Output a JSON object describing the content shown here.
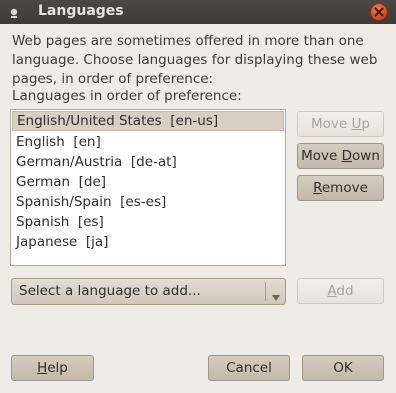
{
  "window": {
    "title": "Languages"
  },
  "intro_text": "Web pages are sometimes offered in more than one language. Choose languages for displaying these web pages, in order of preference:",
  "list_label": "Languages in order of preference:",
  "languages": [
    "English/United States  [en-us]",
    "English  [en]",
    "German/Austria  [de-at]",
    "German  [de]",
    "Spanish/Spain  [es-es]",
    "Spanish  [es]",
    "Japanese  [ja]"
  ],
  "buttons": {
    "move_up_pre": "Move ",
    "move_up_key": "U",
    "move_up_post": "p",
    "move_down_pre": "Move ",
    "move_down_key": "D",
    "move_down_post": "own",
    "remove_key": "R",
    "remove_post": "emove",
    "add_key": "A",
    "add_post": "dd",
    "help_key": "H",
    "help_post": "elp",
    "cancel": "Cancel",
    "ok": "OK"
  },
  "select": {
    "value": "Select a language to add..."
  },
  "icons": {
    "window_menu": "window-menu-icon",
    "close": "close-icon",
    "dropdown": "triangle-down-icon"
  },
  "colors": {
    "titlebar": "#3b3a36",
    "close": "#d4451a",
    "selection": "#d6cfc2"
  }
}
